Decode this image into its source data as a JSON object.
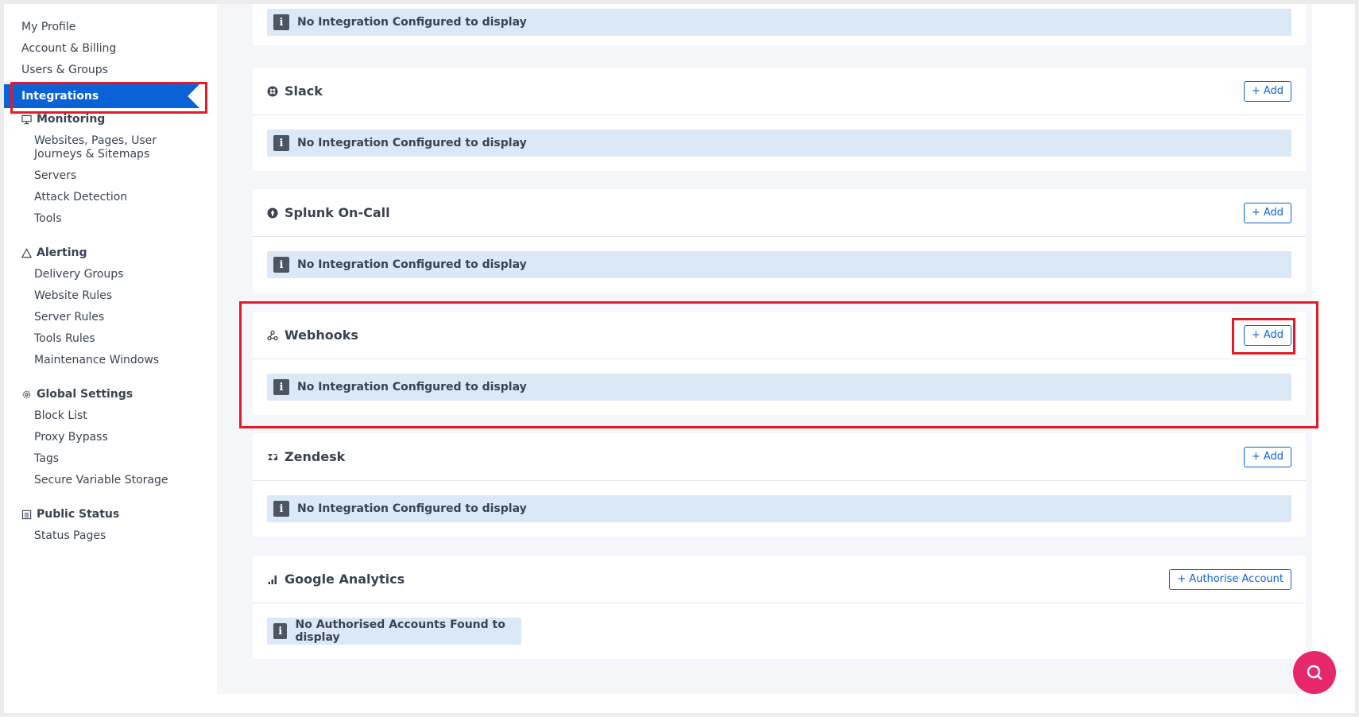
{
  "sidebar": {
    "top_items": [
      "My Profile",
      "Account & Billing",
      "Users & Groups"
    ],
    "active_item": "Integrations",
    "monitoring": {
      "title": "Monitoring",
      "items": [
        "Websites, Pages, User",
        "Journeys & Sitemaps",
        "Servers",
        "Attack Detection",
        "Tools"
      ]
    },
    "alerting": {
      "title": "Alerting",
      "items": [
        "Delivery Groups",
        "Website Rules",
        "Server Rules",
        "Tools Rules",
        "Maintenance Windows"
      ]
    },
    "global_settings": {
      "title": "Global Settings",
      "items": [
        "Block List",
        "Proxy Bypass",
        "Tags",
        "Secure Variable Storage"
      ]
    },
    "public_status": {
      "title": "Public Status",
      "items": [
        "Status Pages"
      ]
    }
  },
  "top_partial": {
    "info_text": "No Integration Configured to display"
  },
  "integrations": [
    {
      "name": "Slack",
      "icon": "slack-icon",
      "button": "Add",
      "info_text": "No Integration Configured to display"
    },
    {
      "name": "Splunk On-Call",
      "icon": "splunk-icon",
      "button": "Add",
      "info_text": "No Integration Configured to display"
    },
    {
      "name": "Webhooks",
      "icon": "webhook-icon",
      "button": "Add",
      "info_text": "No Integration Configured to display"
    },
    {
      "name": "Zendesk",
      "icon": "zendesk-icon",
      "button": "Add",
      "info_text": "No Integration Configured to display"
    },
    {
      "name": "Google Analytics",
      "icon": "bar-chart-icon",
      "button": "Authorise Account",
      "info_text": "No Authorised Accounts Found to display"
    }
  ],
  "info_glyph": "i",
  "plus_glyph": "+",
  "colors": {
    "accent": "#0a63d6",
    "highlight": "#e11b2b",
    "info_bg": "#dbe8f6",
    "fab": "#e8266a"
  }
}
